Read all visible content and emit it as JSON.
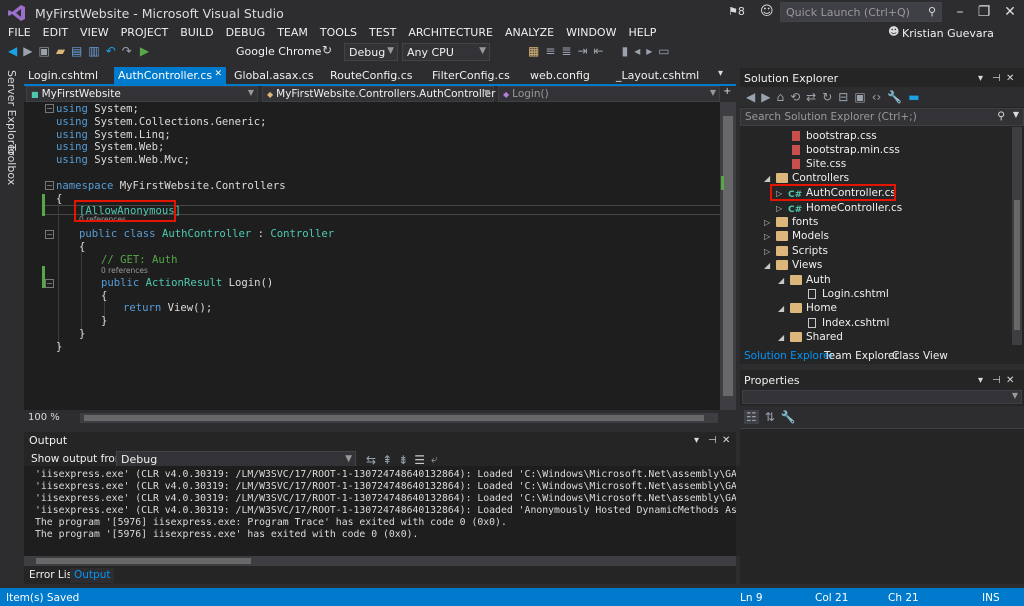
{
  "window": {
    "title": "MyFirstWebsite - Microsoft Visual Studio",
    "notifications_count": "8",
    "quick_launch_placeholder": "Quick Launch (Ctrl+Q)",
    "user_name": "Kristian Guevara"
  },
  "menu": [
    "FILE",
    "EDIT",
    "VIEW",
    "PROJECT",
    "BUILD",
    "DEBUG",
    "TEAM",
    "TOOLS",
    "TEST",
    "ARCHITECTURE",
    "ANALYZE",
    "WINDOW",
    "HELP"
  ],
  "toolbar": {
    "browser": "Google Chrome",
    "configuration": "Debug",
    "platform": "Any CPU"
  },
  "left_strip": {
    "server_explorer": "Server Explorer",
    "toolbox": "Toolbox"
  },
  "tabs": [
    {
      "label": "Login.cshtml",
      "active": false
    },
    {
      "label": "AuthController.cs",
      "active": true
    },
    {
      "label": "Global.asax.cs",
      "active": false
    },
    {
      "label": "RouteConfig.cs",
      "active": false
    },
    {
      "label": "FilterConfig.cs",
      "active": false
    },
    {
      "label": "web.config",
      "active": false
    },
    {
      "label": "_Layout.cshtml",
      "active": false
    }
  ],
  "editor": {
    "project_combo": "MyFirstWebsite",
    "class_combo": "MyFirstWebsite.Controllers.AuthController",
    "member_combo": "Login()",
    "zoom": "100 %",
    "code": {
      "l1_kw": "using",
      "l1_rest": " System;",
      "l2_kw": "using",
      "l2_rest": " System.Collections.Generic;",
      "l3_kw": "using",
      "l3_rest": " System.Linq;",
      "l4_kw": "using",
      "l4_rest": " System.Web;",
      "l5_kw": "using",
      "l5_rest": " System.Web.Mvc;",
      "ns_kw": "namespace",
      "ns_rest": " MyFirstWebsite.Controllers",
      "open1": "{",
      "attr": "[AllowAnonymous]",
      "refs1": "0 references",
      "cls_kw1": "public",
      "cls_kw2": "class",
      "cls_name": "AuthController",
      "cls_colon": " : ",
      "cls_base": "Controller",
      "open2": "{",
      "comment": "// GET: Auth",
      "refs2": "0 references",
      "m_kw": "public",
      "m_type": "ActionResult",
      "m_rest": " Login()",
      "open3": "{",
      "ret_kw": "return",
      "ret_rest": " View();",
      "close3": "}",
      "close2": "}",
      "close1": "}"
    }
  },
  "output": {
    "title": "Output",
    "show_from_label": "Show output from:",
    "source": "Debug",
    "lines": [
      "'iisexpress.exe' (CLR v4.0.30319: /LM/W3SVC/17/ROOT-1-130724748640132864): Loaded 'C:\\Windows\\Microsoft.Net\\assembly\\GAC_MS",
      "'iisexpress.exe' (CLR v4.0.30319: /LM/W3SVC/17/ROOT-1-130724748640132864): Loaded 'C:\\Windows\\Microsoft.Net\\assembly\\GAC_MS",
      "'iisexpress.exe' (CLR v4.0.30319: /LM/W3SVC/17/ROOT-1-130724748640132864): Loaded 'C:\\Windows\\Microsoft.Net\\assembly\\GAC_MS",
      "'iisexpress.exe' (CLR v4.0.30319: /LM/W3SVC/17/ROOT-1-130724748640132864): Loaded 'Anonymously Hosted DynamicMethods Assem",
      "The program '[5976] iisexpress.exe: Program Trace' has exited with code 0 (0x0).",
      "The program '[5976] iisexpress.exe' has exited with code 0 (0x0)."
    ],
    "bottom_tabs": [
      "Error List",
      "Output"
    ]
  },
  "solution_explorer": {
    "title": "Solution Explorer",
    "search_placeholder": "Search Solution Explorer (Ctrl+;)",
    "nodes": [
      {
        "label": "bootstrap.css",
        "kind": "css"
      },
      {
        "label": "bootstrap.min.css",
        "kind": "css"
      },
      {
        "label": "Site.css",
        "kind": "css"
      },
      {
        "label": "Controllers",
        "kind": "folder"
      },
      {
        "label": "AuthController.cs",
        "kind": "cs"
      },
      {
        "label": "HomeController.cs",
        "kind": "cs"
      },
      {
        "label": "fonts",
        "kind": "folder"
      },
      {
        "label": "Models",
        "kind": "folder"
      },
      {
        "label": "Scripts",
        "kind": "folder"
      },
      {
        "label": "Views",
        "kind": "folder"
      },
      {
        "label": "Auth",
        "kind": "folder"
      },
      {
        "label": "Login.cshtml",
        "kind": "cshtml"
      },
      {
        "label": "Home",
        "kind": "folder"
      },
      {
        "label": "Index.cshtml",
        "kind": "cshtml"
      },
      {
        "label": "Shared",
        "kind": "folder"
      }
    ],
    "cs_badge": "C#",
    "tabs": [
      "Solution Explorer",
      "Team Explorer",
      "Class View"
    ]
  },
  "properties": {
    "title": "Properties"
  },
  "statusbar": {
    "message": "Item(s) Saved",
    "line": "Ln 9",
    "col": "Col 21",
    "ch": "Ch 21",
    "mode": "INS"
  },
  "colors": {
    "accent": "#007acc",
    "highlight_box": "#e51400",
    "keyword": "#569cd6",
    "type": "#4ec9b0",
    "comment": "#57a64a"
  }
}
